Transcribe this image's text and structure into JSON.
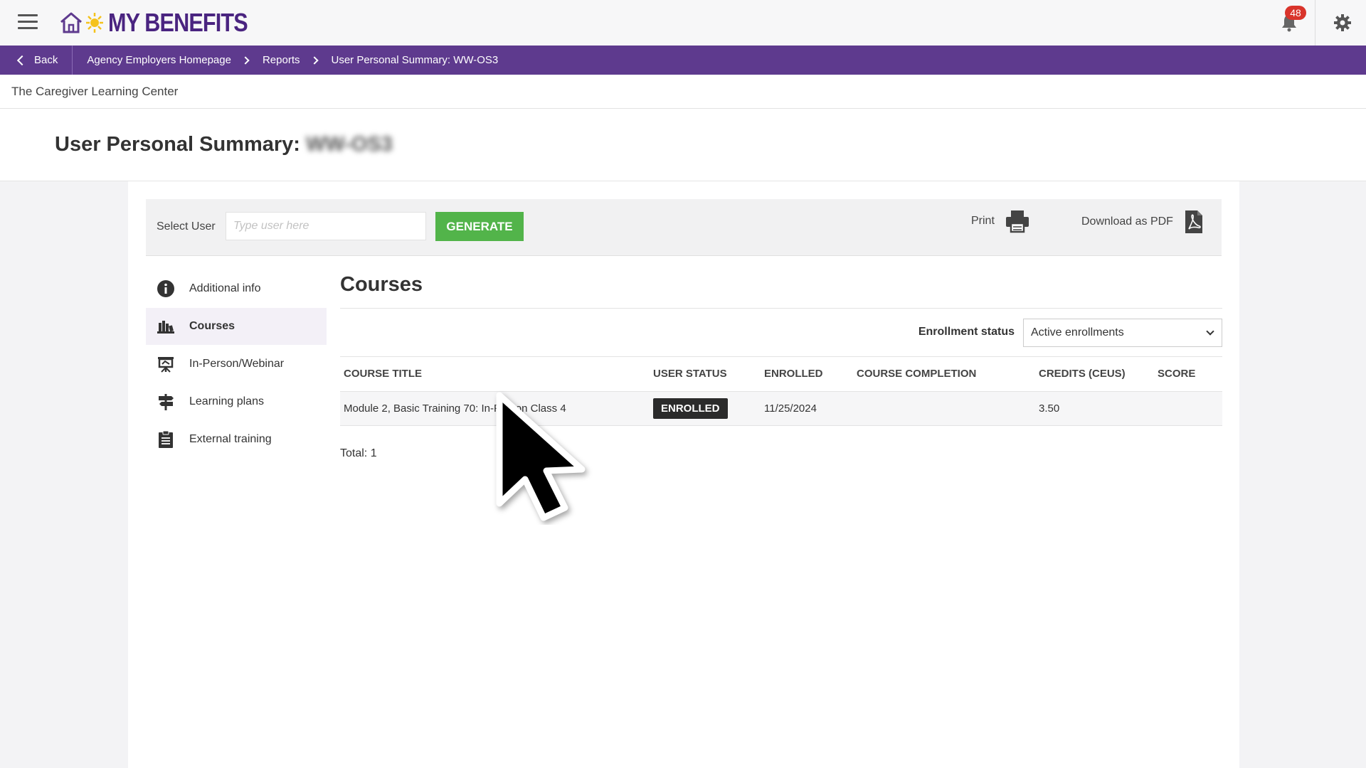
{
  "header": {
    "app_name": "MY BENEFITS",
    "notification_count": "48"
  },
  "breadcrumb": {
    "back_label": "Back",
    "items": [
      "Agency Employers Homepage",
      "Reports",
      "User Personal Summary: WW-OS3"
    ]
  },
  "center_name": "The Caregiver Learning Center",
  "page": {
    "title": "User Personal Summary:",
    "user_id": "WW-OS3"
  },
  "toolbar": {
    "select_user_label": "Select User",
    "user_input_placeholder": "Type user here",
    "user_input_value": "",
    "generate_label": "GENERATE",
    "print_label": "Print",
    "download_label": "Download as PDF"
  },
  "sidenav": {
    "items": [
      {
        "label": "Additional info",
        "icon": "info-icon"
      },
      {
        "label": "Courses",
        "icon": "courses-icon",
        "active": true
      },
      {
        "label": "In-Person/Webinar",
        "icon": "presentation-icon"
      },
      {
        "label": "Learning plans",
        "icon": "signpost-icon"
      },
      {
        "label": "External training",
        "icon": "clipboard-icon"
      }
    ]
  },
  "courses": {
    "heading": "Courses",
    "filter_label": "Enrollment status",
    "filter_value": "Active enrollments",
    "columns": [
      "COURSE TITLE",
      "USER STATUS",
      "ENROLLED",
      "COURSE COMPLETION",
      "CREDITS (CEUS)",
      "SCORE"
    ],
    "rows": [
      {
        "title": "Module 2, Basic Training 70: In-Person Class 4",
        "status": "ENROLLED",
        "enrolled": "11/25/2024",
        "completion": "",
        "credits": "3.50",
        "score": ""
      }
    ],
    "total": "Total: 1"
  },
  "colors": {
    "brand_purple": "#5e3a8e",
    "generate_green": "#52b44a",
    "badge_red": "#d9342b"
  }
}
